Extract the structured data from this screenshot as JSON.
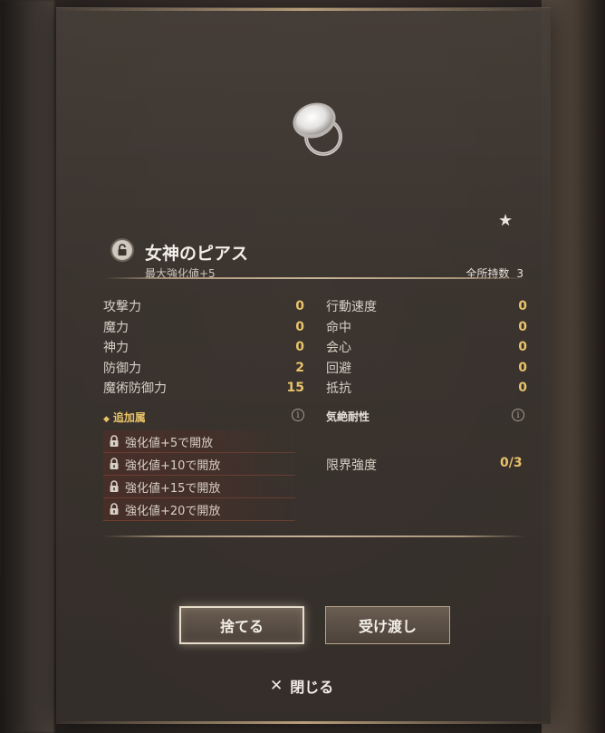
{
  "item": {
    "name": "女神のピアス",
    "subtitle": "最大強化値+5",
    "owned_label": "全所持数",
    "owned_count": "3",
    "rarity_icon": "star-icon"
  },
  "stats_left": [
    {
      "label": "攻撃力",
      "value": "0"
    },
    {
      "label": "魔力",
      "value": "0"
    },
    {
      "label": "神力",
      "value": "0"
    },
    {
      "label": "防御力",
      "value": "2"
    },
    {
      "label": "魔術防御力",
      "value": "15"
    }
  ],
  "stats_right": [
    {
      "label": "行動速度",
      "value": "0"
    },
    {
      "label": "命中",
      "value": "0"
    },
    {
      "label": "会心",
      "value": "0"
    },
    {
      "label": "回避",
      "value": "0"
    },
    {
      "label": "抵抗",
      "value": "0"
    }
  ],
  "additional": {
    "title": "追加属",
    "locks": [
      "強化値+5で開放",
      "強化値+10で開放",
      "強化値+15で開放",
      "強化値+20で開放"
    ]
  },
  "resist": {
    "title": "気絶耐性"
  },
  "limit": {
    "label": "限界強度",
    "value": "0/3"
  },
  "buttons": {
    "discard": "捨てる",
    "transfer": "受け渡し",
    "close": "閉じる"
  },
  "colors": {
    "accent_gold": "#e8c36a",
    "panel": "#3a332e"
  }
}
